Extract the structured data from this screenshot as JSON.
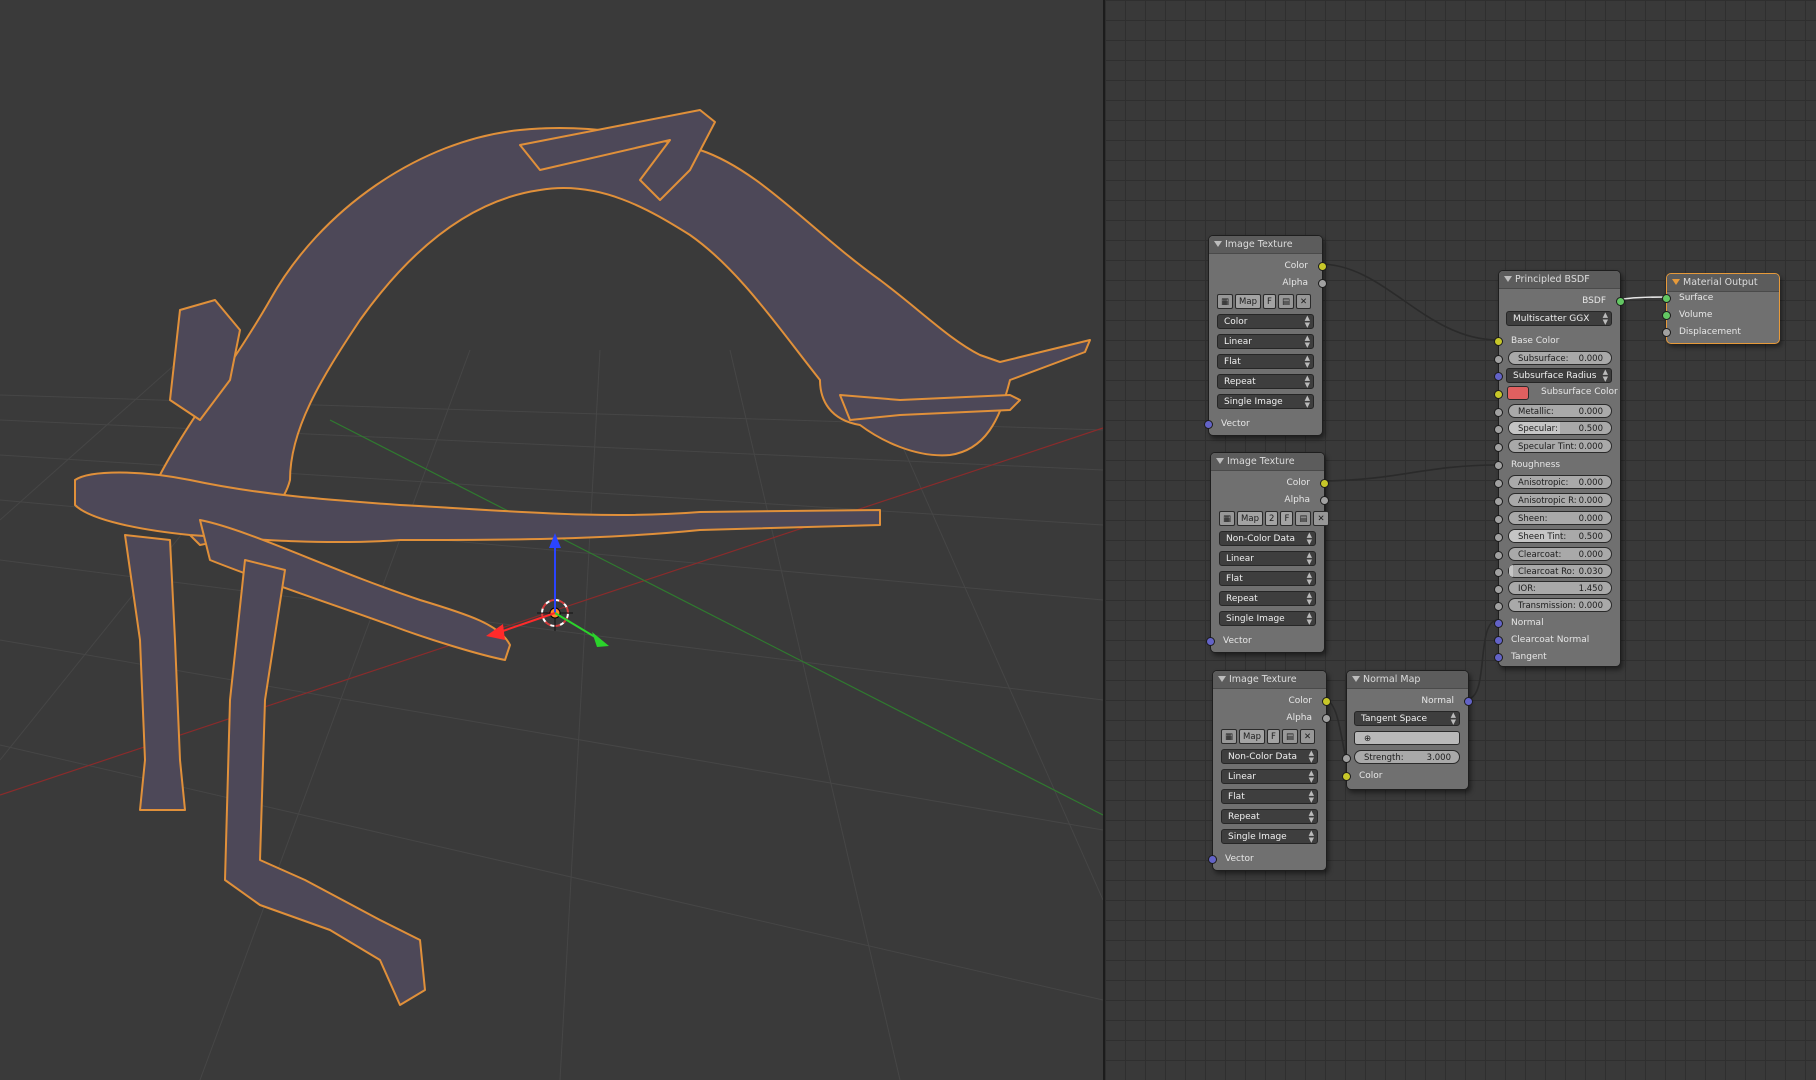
{
  "colors": {
    "socket_color": "#c7c729",
    "socket_float": "#a1a1a1",
    "socket_vector": "#6363c7",
    "socket_shader": "#63c763",
    "selection": "#e79a3a",
    "subsurface_color": "#e06060"
  },
  "nodes": {
    "tex1": {
      "title": "Image Texture",
      "out_color": "Color",
      "out_alpha": "Alpha",
      "map_btn": "Map",
      "user_count": "",
      "fake_btn": "F",
      "color_space": "Color",
      "interpolation": "Linear",
      "projection": "Flat",
      "extension": "Repeat",
      "source": "Single Image",
      "in_vector": "Vector"
    },
    "tex2": {
      "title": "Image Texture",
      "out_color": "Color",
      "out_alpha": "Alpha",
      "map_btn": "Map",
      "user_count": "2",
      "fake_btn": "F",
      "color_space": "Non-Color Data",
      "interpolation": "Linear",
      "projection": "Flat",
      "extension": "Repeat",
      "source": "Single Image",
      "in_vector": "Vector"
    },
    "tex3": {
      "title": "Image Texture",
      "out_color": "Color",
      "out_alpha": "Alpha",
      "map_btn": "Map",
      "user_count": "",
      "fake_btn": "F",
      "color_space": "Non-Color Data",
      "interpolation": "Linear",
      "projection": "Flat",
      "extension": "Repeat",
      "source": "Single Image",
      "in_vector": "Vector"
    },
    "normal_map": {
      "title": "Normal Map",
      "out_normal": "Normal",
      "space": "Tangent Space",
      "uv_map": "",
      "strength_label": "Strength:",
      "strength_value": "3.000",
      "in_color": "Color"
    },
    "principled": {
      "title": "Principled BSDF",
      "out_bsdf": "BSDF",
      "distribution": "Multiscatter GGX",
      "base_color": "Base Color",
      "subsurface_label": "Subsurface:",
      "subsurface_value": "0.000",
      "subsurface_radius": "Subsurface Radius",
      "subsurface_color": "Subsurface Color",
      "metallic_label": "Metallic:",
      "metallic_value": "0.000",
      "specular_label": "Specular:",
      "specular_value": "0.500",
      "specular_tint_label": "Specular Tint:",
      "specular_tint_value": "0.000",
      "roughness": "Roughness",
      "anisotropic_label": "Anisotropic:",
      "anisotropic_value": "0.000",
      "anisotropic_rot_label": "Anisotropic R:",
      "anisotropic_rot_value": "0.000",
      "sheen_label": "Sheen:",
      "sheen_value": "0.000",
      "sheen_tint_label": "Sheen Tint:",
      "sheen_tint_value": "0.500",
      "clearcoat_label": "Clearcoat:",
      "clearcoat_value": "0.000",
      "clearcoat_rough_label": "Clearcoat Ro:",
      "clearcoat_rough_value": "0.030",
      "ior_label": "IOR:",
      "ior_value": "1.450",
      "transmission_label": "Transmission:",
      "transmission_value": "0.000",
      "normal": "Normal",
      "clearcoat_normal": "Clearcoat Normal",
      "tangent": "Tangent"
    },
    "output": {
      "title": "Material Output",
      "surface": "Surface",
      "volume": "Volume",
      "displacement": "Displacement"
    }
  }
}
